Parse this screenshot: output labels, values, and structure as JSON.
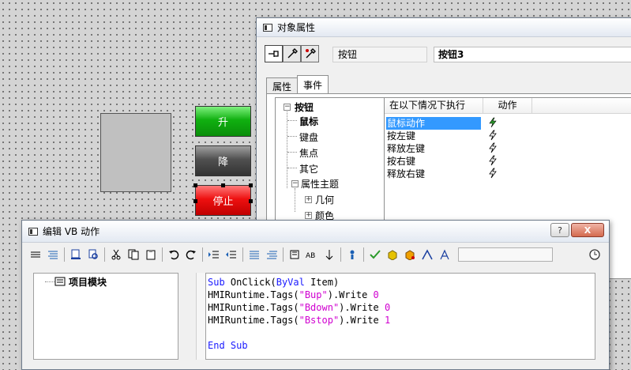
{
  "canvas": {
    "buttons": [
      {
        "label": "升",
        "color": "#10b010"
      },
      {
        "label": "降",
        "color": "#505050"
      },
      {
        "label": "停止",
        "color": "#ee1010"
      }
    ]
  },
  "properties_window": {
    "title": "对象属性",
    "object_type": "按钮",
    "object_name": "按钮3",
    "tabs": [
      {
        "label": "属性",
        "active": false
      },
      {
        "label": "事件",
        "active": true
      }
    ],
    "tree": {
      "root": "按钮",
      "children": [
        "鼠标",
        "键盘",
        "焦点",
        "其它"
      ],
      "group": "属性主题",
      "group_children": [
        "几何",
        "颜色"
      ]
    },
    "event_list": {
      "headers": [
        "在以下情况下执行",
        "动作"
      ],
      "rows": [
        "鼠标动作",
        "按左键",
        "释放左键",
        "按右键",
        "释放右键"
      ]
    }
  },
  "vb_window": {
    "title": "编辑 VB 动作",
    "tree_item": "项目模块",
    "code": {
      "line1": {
        "kw": "Sub",
        "name": " OnClick(",
        "kw2": "ByVal",
        "rest": " Item)"
      },
      "line2": {
        "pre": "HMIRuntime.Tags(",
        "str": "\"Bup\"",
        "post": ").Write ",
        "num": "0"
      },
      "line3": {
        "pre": "HMIRuntime.Tags(",
        "str": "\"Bdown\"",
        "post": ").Write ",
        "num": "0"
      },
      "line4": {
        "pre": "HMIRuntime.Tags(",
        "str": "\"Bstop\"",
        "post": ").Write ",
        "num": "1"
      },
      "line6": {
        "kw": "End",
        "kw2": "Sub"
      }
    },
    "title_buttons": {
      "help": "?",
      "close": "X"
    }
  }
}
